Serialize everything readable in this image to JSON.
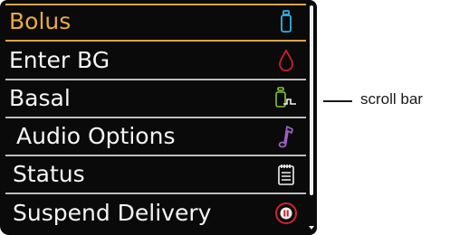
{
  "menu": {
    "items": [
      {
        "label": "Bolus",
        "icon": "insulin-vial-icon",
        "icon_color": "#2bb3e6",
        "selected": true
      },
      {
        "label": "Enter BG",
        "icon": "blood-drop-icon",
        "icon_color": "#c8202e",
        "selected": false
      },
      {
        "label": "Basal",
        "icon": "basal-profile-icon",
        "icon_color": "#7fc241",
        "selected": false
      },
      {
        "label": "Audio Options",
        "icon": "music-note-icon",
        "icon_color": "#9b5fc0",
        "selected": false
      },
      {
        "label": "Status",
        "icon": "notepad-icon",
        "icon_color": "#f0f0f0",
        "selected": false
      },
      {
        "label": "Suspend Delivery",
        "icon": "pause-circle-icon",
        "icon_color": "#d0232e",
        "selected": false
      }
    ],
    "selected_color": "#e9ad3a",
    "text_color": "#f5f5f5"
  },
  "annotation": {
    "scroll_bar_label": "scroll bar"
  }
}
